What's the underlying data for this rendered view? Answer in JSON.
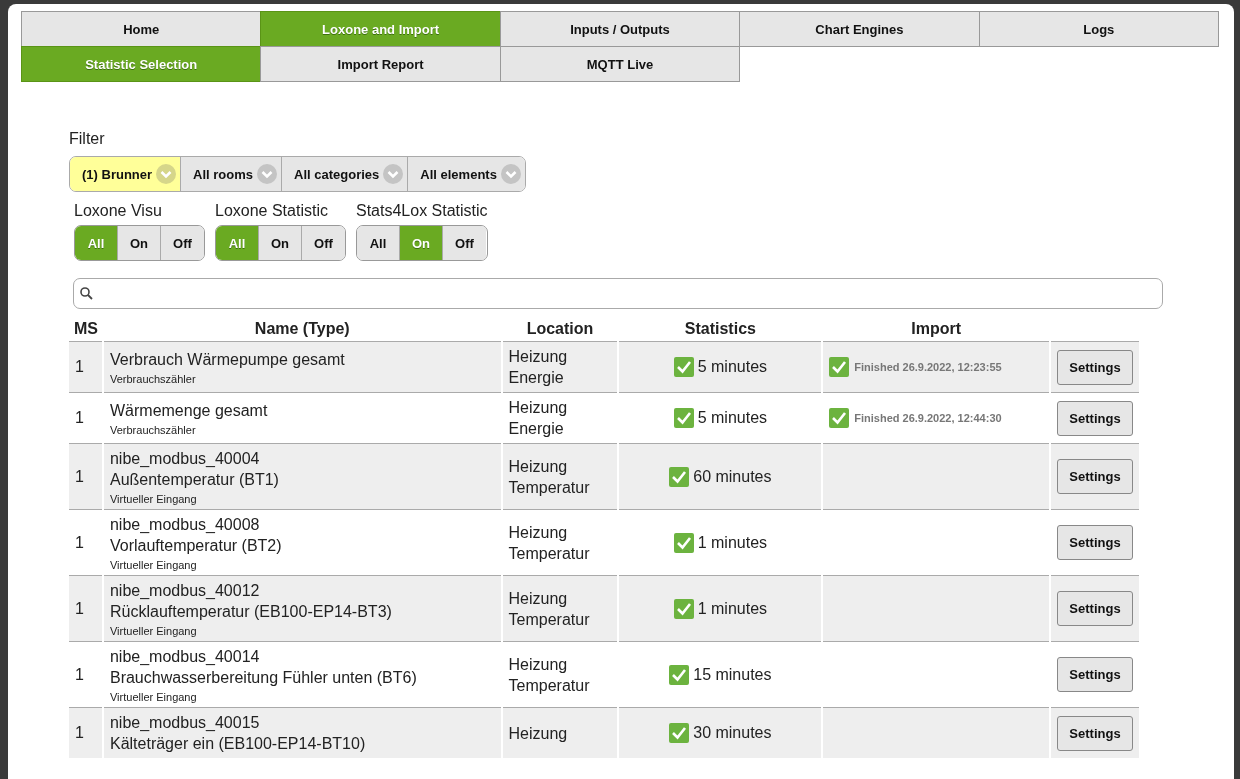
{
  "tabs_main": [
    {
      "label": "Home",
      "selected": false
    },
    {
      "label": "Loxone and Import",
      "selected": true
    },
    {
      "label": "Inputs / Outputs",
      "selected": false
    },
    {
      "label": "Chart Engines",
      "selected": false
    },
    {
      "label": "Logs",
      "selected": false
    }
  ],
  "tabs_sub": [
    {
      "label": "Statistic Selection",
      "selected": true
    },
    {
      "label": "Import Report",
      "selected": false
    },
    {
      "label": "MQTT Live",
      "selected": false
    }
  ],
  "filter": {
    "label": "Filter",
    "selects": [
      {
        "value": "(1) Brunner",
        "highlighted": true
      },
      {
        "value": "All rooms",
        "highlighted": false
      },
      {
        "value": "All categories",
        "highlighted": false
      },
      {
        "value": "All elements",
        "highlighted": false
      }
    ]
  },
  "toggle_groups": [
    {
      "label": "Loxone Visu",
      "options": [
        {
          "label": "All",
          "selected": true
        },
        {
          "label": "On",
          "selected": false
        },
        {
          "label": "Off",
          "selected": false
        }
      ]
    },
    {
      "label": "Loxone Statistic",
      "options": [
        {
          "label": "All",
          "selected": true
        },
        {
          "label": "On",
          "selected": false
        },
        {
          "label": "Off",
          "selected": false
        }
      ]
    },
    {
      "label": "Stats4Lox Statistic",
      "options": [
        {
          "label": "All",
          "selected": false
        },
        {
          "label": "On",
          "selected": true
        },
        {
          "label": "Off",
          "selected": false
        }
      ]
    }
  ],
  "table": {
    "columns": [
      "MS",
      "Name (Type)",
      "Location",
      "Statistics",
      "Import"
    ],
    "rows": [
      {
        "ms": "1",
        "name": [
          "Verbrauch Wärmepumpe gesamt"
        ],
        "type": "Verbrauchszähler",
        "location": [
          "Heizung",
          "Energie"
        ],
        "stat_checked": true,
        "statistics": "5 minutes",
        "import_checked": true,
        "import": "Finished 26.9.2022, 12:23:55",
        "button": "Settings"
      },
      {
        "ms": "1",
        "name": [
          "Wärmemenge gesamt"
        ],
        "type": "Verbrauchszähler",
        "location": [
          "Heizung",
          "Energie"
        ],
        "stat_checked": true,
        "statistics": "5 minutes",
        "import_checked": true,
        "import": "Finished 26.9.2022, 12:44:30",
        "button": "Settings"
      },
      {
        "ms": "1",
        "name": [
          "nibe_modbus_40004",
          "Außentemperatur (BT1)"
        ],
        "type": "Virtueller Eingang",
        "location": [
          "Heizung",
          "Temperatur"
        ],
        "stat_checked": true,
        "statistics": "60 minutes",
        "import_checked": false,
        "button": "Settings"
      },
      {
        "ms": "1",
        "name": [
          "nibe_modbus_40008",
          "Vorlauftemperatur (BT2)"
        ],
        "type": "Virtueller Eingang",
        "location": [
          "Heizung",
          "Temperatur"
        ],
        "stat_checked": true,
        "statistics": "1 minutes",
        "import_checked": false,
        "button": "Settings"
      },
      {
        "ms": "1",
        "name": [
          "nibe_modbus_40012",
          "Rücklauftemperatur (EB100-EP14-BT3)"
        ],
        "type": "Virtueller Eingang",
        "location": [
          "Heizung",
          "Temperatur"
        ],
        "stat_checked": true,
        "statistics": "1 minutes",
        "import_checked": false,
        "button": "Settings"
      },
      {
        "ms": "1",
        "name": [
          "nibe_modbus_40014",
          "Brauchwasserbereitung Fühler unten (BT6)"
        ],
        "type": "Virtueller Eingang",
        "location": [
          "Heizung",
          "Temperatur"
        ],
        "stat_checked": true,
        "statistics": "15 minutes",
        "import_checked": false,
        "button": "Settings"
      },
      {
        "ms": "1",
        "name": [
          "nibe_modbus_40015",
          "Kälteträger ein (EB100-EP14-BT10)"
        ],
        "location": [
          "Heizung"
        ],
        "stat_checked": true,
        "statistics": "30 minutes",
        "import_checked": false,
        "button": "Settings"
      }
    ]
  }
}
